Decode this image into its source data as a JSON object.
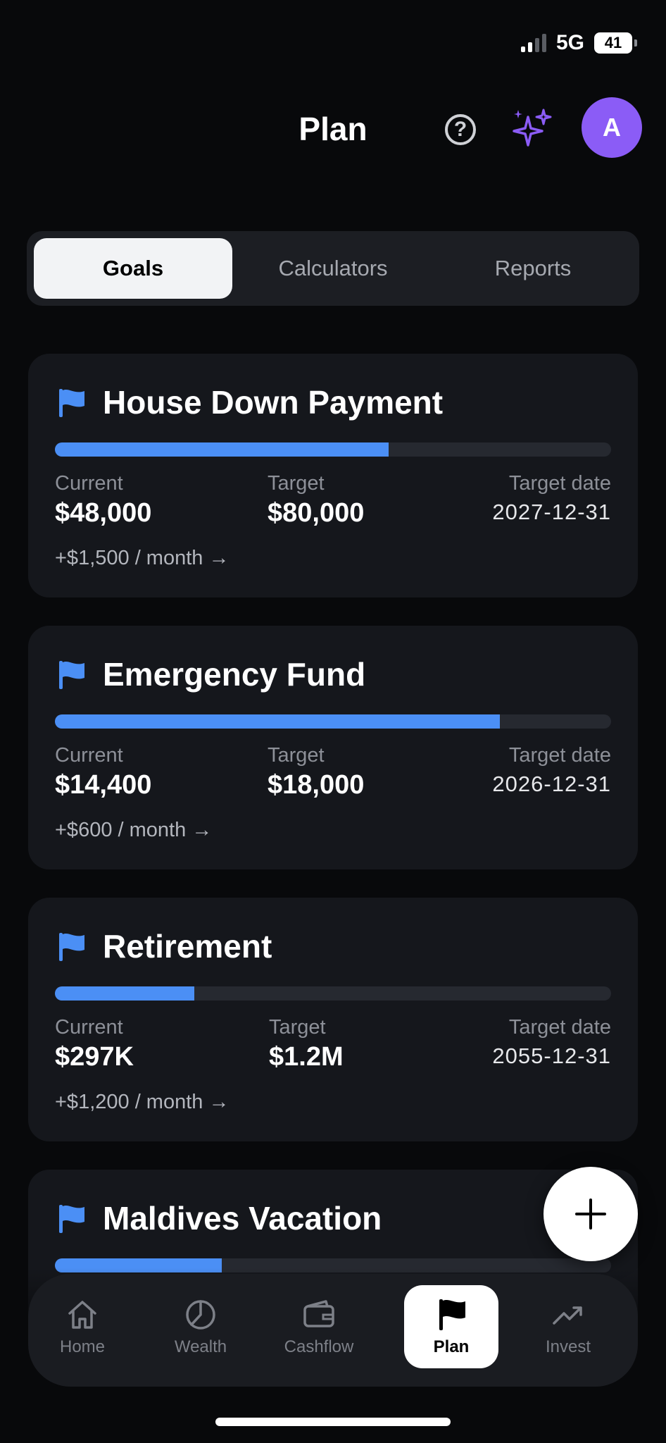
{
  "status_bar": {
    "network": "5G",
    "battery": "41"
  },
  "header": {
    "title": "Plan",
    "avatar_initial": "A"
  },
  "tabs": [
    {
      "label": "Goals",
      "active": true
    },
    {
      "label": "Calculators",
      "active": false
    },
    {
      "label": "Reports",
      "active": false
    }
  ],
  "goals": [
    {
      "name": "House Down Payment",
      "progress": 0.6,
      "current_label": "Current",
      "current": "$48,000",
      "target_label": "Target",
      "target": "$80,000",
      "date_label": "Target date",
      "date": "2027-12-31",
      "monthly": "+$1,500 / month →"
    },
    {
      "name": "Emergency Fund",
      "progress": 0.8,
      "current_label": "Current",
      "current": "$14,400",
      "target_label": "Target",
      "target": "$18,000",
      "date_label": "Target date",
      "date": "2026-12-31",
      "monthly": "+$600 / month →"
    },
    {
      "name": "Retirement",
      "progress": 0.25,
      "current_label": "Current",
      "current": "$297K",
      "target_label": "Target",
      "target": "$1.2M",
      "date_label": "Target date",
      "date": "2055-12-31",
      "monthly": "+$1,200 / month →"
    },
    {
      "name": "Maldives Vacation",
      "progress": 0.3
    }
  ],
  "nav": [
    {
      "label": "Home",
      "icon": "home-icon",
      "active": false
    },
    {
      "label": "Wealth",
      "icon": "pie-chart-icon",
      "active": false
    },
    {
      "label": "Cashflow",
      "icon": "wallet-icon",
      "active": false
    },
    {
      "label": "Plan",
      "icon": "flag-icon",
      "active": true
    },
    {
      "label": "Invest",
      "icon": "trending-up-icon",
      "active": false
    }
  ],
  "colors": {
    "accent": "#4b8ff5",
    "avatar": "#8b5cf6",
    "sparkle": "#8b5cf6",
    "card": "#15171c"
  }
}
